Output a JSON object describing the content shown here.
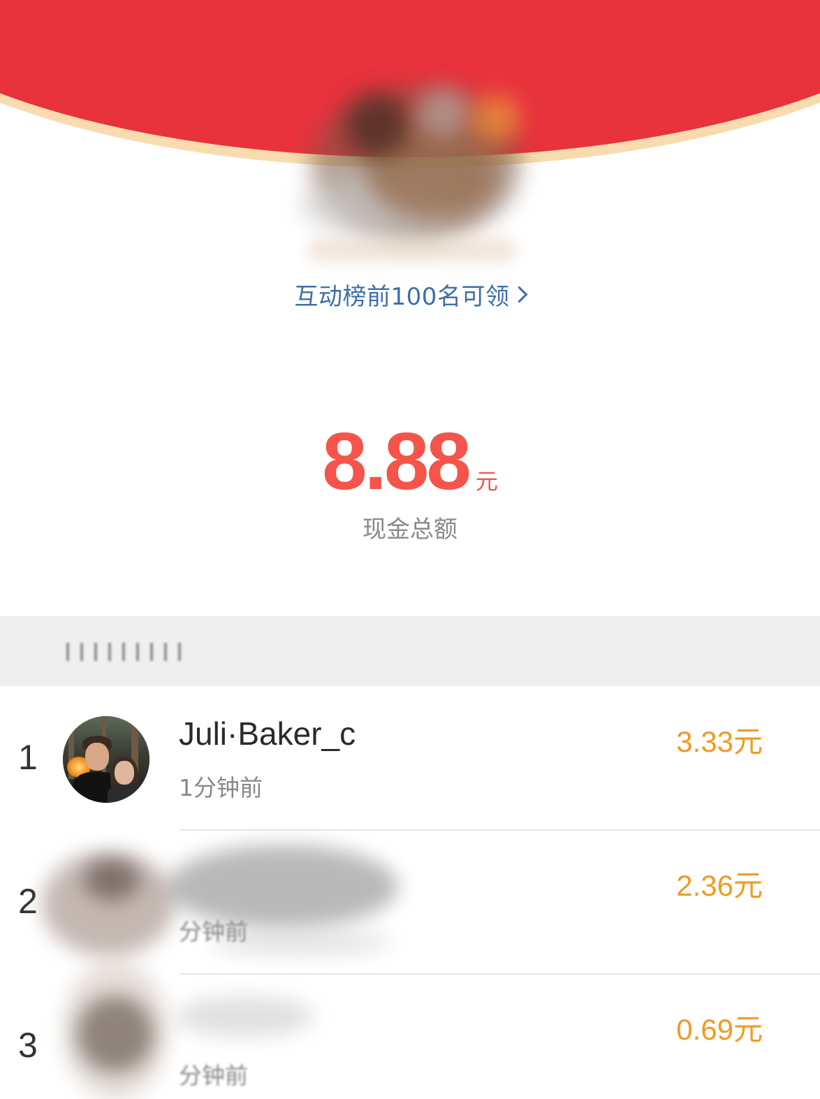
{
  "header": {
    "rank_link_text": "互动榜前100名可领",
    "chevron_icon": "chevron-right-icon"
  },
  "amount": {
    "value": "8.88",
    "unit": "元",
    "label": "现金总额"
  },
  "list": {
    "rows": [
      {
        "rank": "1",
        "name": "Juli·Baker_c",
        "time": "1分钟前",
        "money": "3.33元"
      },
      {
        "rank": "2",
        "name": "",
        "time": "分钟前",
        "money": "2.36元"
      },
      {
        "rank": "3",
        "name": "",
        "time": "分钟前",
        "money": "0.69元"
      }
    ]
  },
  "colors": {
    "header_red": "#e8323d",
    "header_rim": "#f8dcb0",
    "amount_red": "#f5544a",
    "link_blue": "#3d6fa8",
    "money_orange": "#f19a23",
    "band_gray": "#efefef"
  }
}
